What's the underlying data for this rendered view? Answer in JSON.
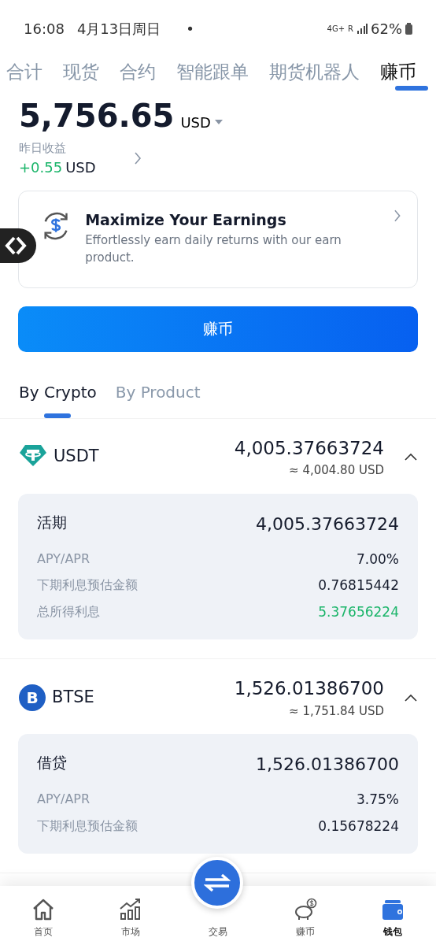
{
  "status_bar": {
    "time": "16:08",
    "date": "4月13日周日",
    "notification_dot": "•",
    "network": "4G+",
    "roaming": "R",
    "battery": "62%"
  },
  "top_tabs": [
    {
      "label": "合计",
      "selected": false
    },
    {
      "label": "现货",
      "selected": false
    },
    {
      "label": "合约",
      "selected": false
    },
    {
      "label": "智能跟单",
      "selected": false
    },
    {
      "label": "期货机器人",
      "selected": false
    },
    {
      "label": "赚币",
      "selected": true
    }
  ],
  "balance": {
    "amount": "5,756.65",
    "currency": "USD",
    "yesterday_label": "昨日收益",
    "yesterday_value": "+0.55",
    "yesterday_currency": "USD"
  },
  "promo": {
    "title": "Maximize Your Earnings",
    "description": "Effortlessly earn daily returns with our earn product."
  },
  "earn_button": "赚币",
  "view_tabs": [
    {
      "label": "By Crypto",
      "selected": true
    },
    {
      "label": "By Product",
      "selected": false
    }
  ],
  "assets": [
    {
      "kind": "tether",
      "symbol": "USDT",
      "amount": "4,005.37663724",
      "approx": "≈ 4,004.80 USD",
      "expanded": true,
      "detail": {
        "product": "活期",
        "amount": "4,005.37663724",
        "rows": [
          {
            "label": "APY/APR",
            "value": "7.00%",
            "positive": false
          },
          {
            "label": "下期利息预估金额",
            "value": "0.76815442",
            "positive": false
          },
          {
            "label": "总所得利息",
            "value": "5.37656224",
            "positive": true
          }
        ]
      }
    },
    {
      "kind": "btse",
      "logo_letter": "B",
      "symbol": "BTSE",
      "amount": "1,526.01386700",
      "approx": "≈ 1,751.84 USD",
      "expanded": true,
      "detail": {
        "product": "借贷",
        "amount": "1,526.01386700",
        "rows": [
          {
            "label": "APY/APR",
            "value": "3.75%",
            "positive": false
          },
          {
            "label": "下期利息预估金额",
            "value": "0.15678224",
            "positive": false
          }
        ]
      }
    }
  ],
  "bottom_nav": [
    {
      "kind": "home",
      "label": "首页",
      "selected": false
    },
    {
      "kind": "market",
      "label": "市场",
      "selected": false
    },
    {
      "kind": "trade",
      "label": "交易",
      "selected": false
    },
    {
      "kind": "earn",
      "label": "赚币",
      "selected": false
    },
    {
      "kind": "wallet",
      "label": "钱包",
      "selected": true
    }
  ]
}
